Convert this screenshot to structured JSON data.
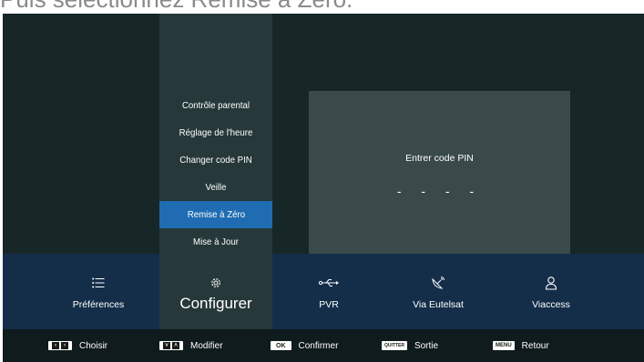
{
  "caption_cut": "Puis sélectionnez Remise à Zéro.",
  "menu": {
    "items": [
      {
        "label": "Contrôle parental"
      },
      {
        "label": "Réglage de l'heure"
      },
      {
        "label": "Changer code PIN"
      },
      {
        "label": "Veille"
      },
      {
        "label": "Remise à Zéro",
        "selected": true
      },
      {
        "label": "Mise à Jour"
      }
    ]
  },
  "pin": {
    "label": "Entrer code PIN",
    "mask": "- - - -"
  },
  "nav": {
    "items": [
      {
        "label": "Préférences",
        "icon": "list-icon"
      },
      {
        "label": "Configurer",
        "icon": "gear-icon",
        "active": true
      },
      {
        "label": "PVR",
        "icon": "usb-icon"
      },
      {
        "label": "Via Eutelsat",
        "icon": "satellite-icon"
      },
      {
        "label": "Viaccess",
        "icon": "user-icon"
      }
    ]
  },
  "footer": {
    "choisir": {
      "keys": "< >",
      "label": "Choisir"
    },
    "modifier": {
      "keys": "v ^",
      "label": "Modifier"
    },
    "confirmer": {
      "key": "OK",
      "label": "Confirmer"
    },
    "sortie": {
      "key": "QUITTER",
      "label": "Sortie"
    },
    "retour": {
      "key": "MENU",
      "label": "Retour"
    }
  },
  "colors": {
    "background": "#172627",
    "column": "#263839",
    "selected": "#1f6cb2",
    "panel": "#3a4a4b",
    "nav_bar": "#142e4a",
    "footer": "#0f1b1c"
  }
}
